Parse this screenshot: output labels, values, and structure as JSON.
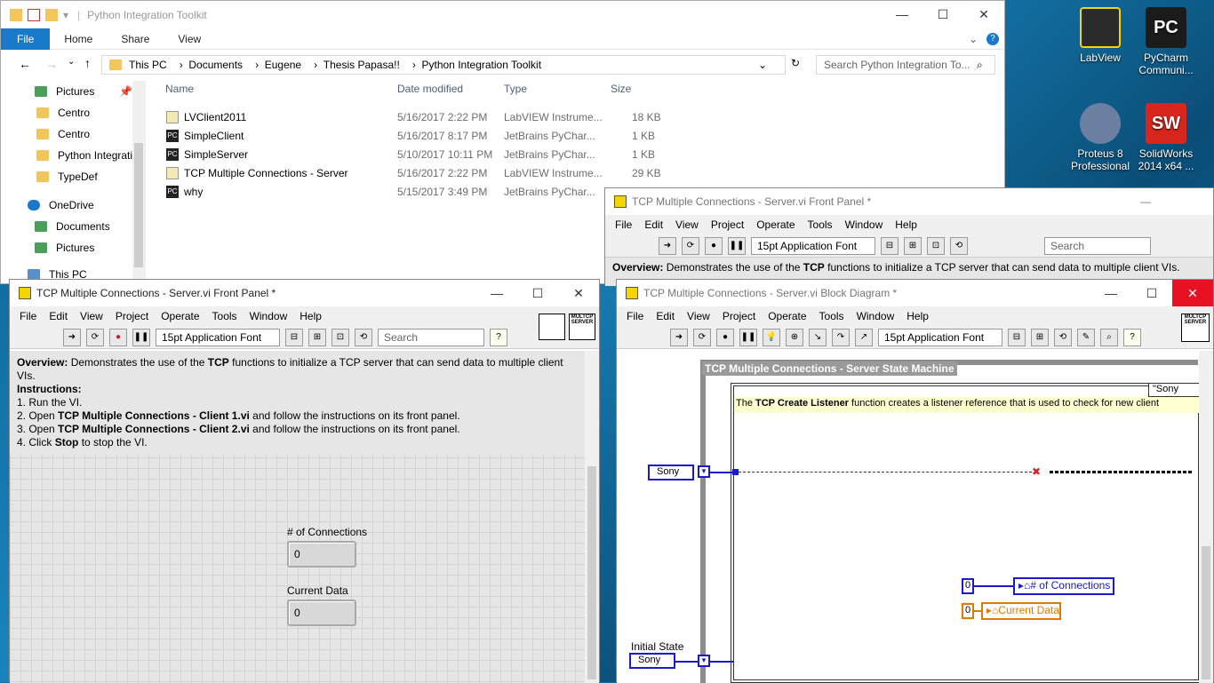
{
  "desktop": {
    "icons": [
      {
        "label1": "LabView",
        "label2": "",
        "color": "#2b2b2b"
      },
      {
        "label1": "PyCharm",
        "label2": "Communi...",
        "color": "#1b1b1b"
      },
      {
        "label1": "Proteus 8",
        "label2": "Professional",
        "color": "#6b7fa0"
      },
      {
        "label1": "SolidWorks",
        "label2": "2014 x64 ...",
        "color": "#d8261d"
      }
    ]
  },
  "explorer": {
    "title": "Python Integration Toolkit",
    "ribbon": [
      "File",
      "Home",
      "Share",
      "View"
    ],
    "path": [
      "This PC",
      "Documents",
      "Eugene",
      "Thesis Papasa!!",
      "Python Integration Toolkit"
    ],
    "search_placeholder": "Search Python Integration To...",
    "nav": [
      "Pictures",
      "Centro",
      "Centro",
      "Python Integrati",
      "TypeDef",
      "OneDrive",
      "Documents",
      "Pictures",
      "This PC"
    ],
    "columns": [
      "Name",
      "Date modified",
      "Type",
      "Size"
    ],
    "files": [
      {
        "name": "LVClient2011",
        "date": "5/16/2017 2:22 PM",
        "type": "LabVIEW Instrume...",
        "size": "18 KB",
        "kind": "lv"
      },
      {
        "name": "SimpleClient",
        "date": "5/16/2017 8:17 PM",
        "type": "JetBrains PyChar...",
        "size": "1 KB",
        "kind": "pc"
      },
      {
        "name": "SimpleServer",
        "date": "5/10/2017 10:11 PM",
        "type": "JetBrains PyChar...",
        "size": "1 KB",
        "kind": "pc"
      },
      {
        "name": "TCP Multiple Connections - Server",
        "date": "5/16/2017 2:22 PM",
        "type": "LabVIEW Instrume...",
        "size": "29 KB",
        "kind": "lv"
      },
      {
        "name": "why",
        "date": "5/15/2017 3:49 PM",
        "type": "JetBrains PyChar...",
        "size": "",
        "kind": "pc"
      }
    ]
  },
  "lv_menu": [
    "File",
    "Edit",
    "View",
    "Project",
    "Operate",
    "Tools",
    "Window",
    "Help"
  ],
  "fp_back": {
    "title": "TCP Multiple Connections - Server.vi Front Panel *",
    "font": "15pt Application Font",
    "search": "Search",
    "overview_pre": "Overview:",
    "overview_text": " Demonstrates the use of the ",
    "overview_bold": "TCP",
    "overview_end": " functions to initialize a TCP server that can send data to multiple client VIs."
  },
  "fp": {
    "title": "TCP Multiple Connections - Server.vi Front Panel *",
    "font": "15pt Application Font",
    "search": "Search",
    "overview_pre": "Overview:",
    "overview_text": " Demonstrates the use of the ",
    "overview_bold": "TCP",
    "overview_end": " functions to initialize a TCP server that can send data to multiple client VIs.",
    "instructions": "Instructions:",
    "steps": [
      {
        "pre": "1. Run the VI.",
        "bold": "",
        "post": ""
      },
      {
        "pre": "2. Open ",
        "bold": "TCP Multiple Connections - Client 1.vi",
        "post": " and follow the instructions on its front panel."
      },
      {
        "pre": "3. Open ",
        "bold": "TCP Multiple Connections - Client 2.vi",
        "post": " and follow the instructions on its front panel."
      },
      {
        "pre": "4. Click ",
        "bold": "Stop",
        "post": " to stop the VI."
      }
    ],
    "connections_label": "# of Connections",
    "connections_value": "0",
    "current_label": "Current Data",
    "current_value": "0",
    "icon_text": "MULTCP SERVER"
  },
  "bd": {
    "title": "TCP Multiple Connections - Server.vi Block Diagram *",
    "font": "15pt Application Font",
    "state_machine": "TCP Multiple Connections - Server State Machine",
    "case_label": "\"Sony",
    "comment_pre": "The ",
    "comment_bold": "TCP Create Listener",
    "comment_post": " function creates a listener reference that is used to check for new client",
    "enum_value": "Sony",
    "initial_state": "Initial State",
    "conn_const": "0",
    "conn_label": "# of Connections",
    "cur_const": "0",
    "cur_label": "Current Data",
    "icon_text": "MULTCP SERVER"
  }
}
